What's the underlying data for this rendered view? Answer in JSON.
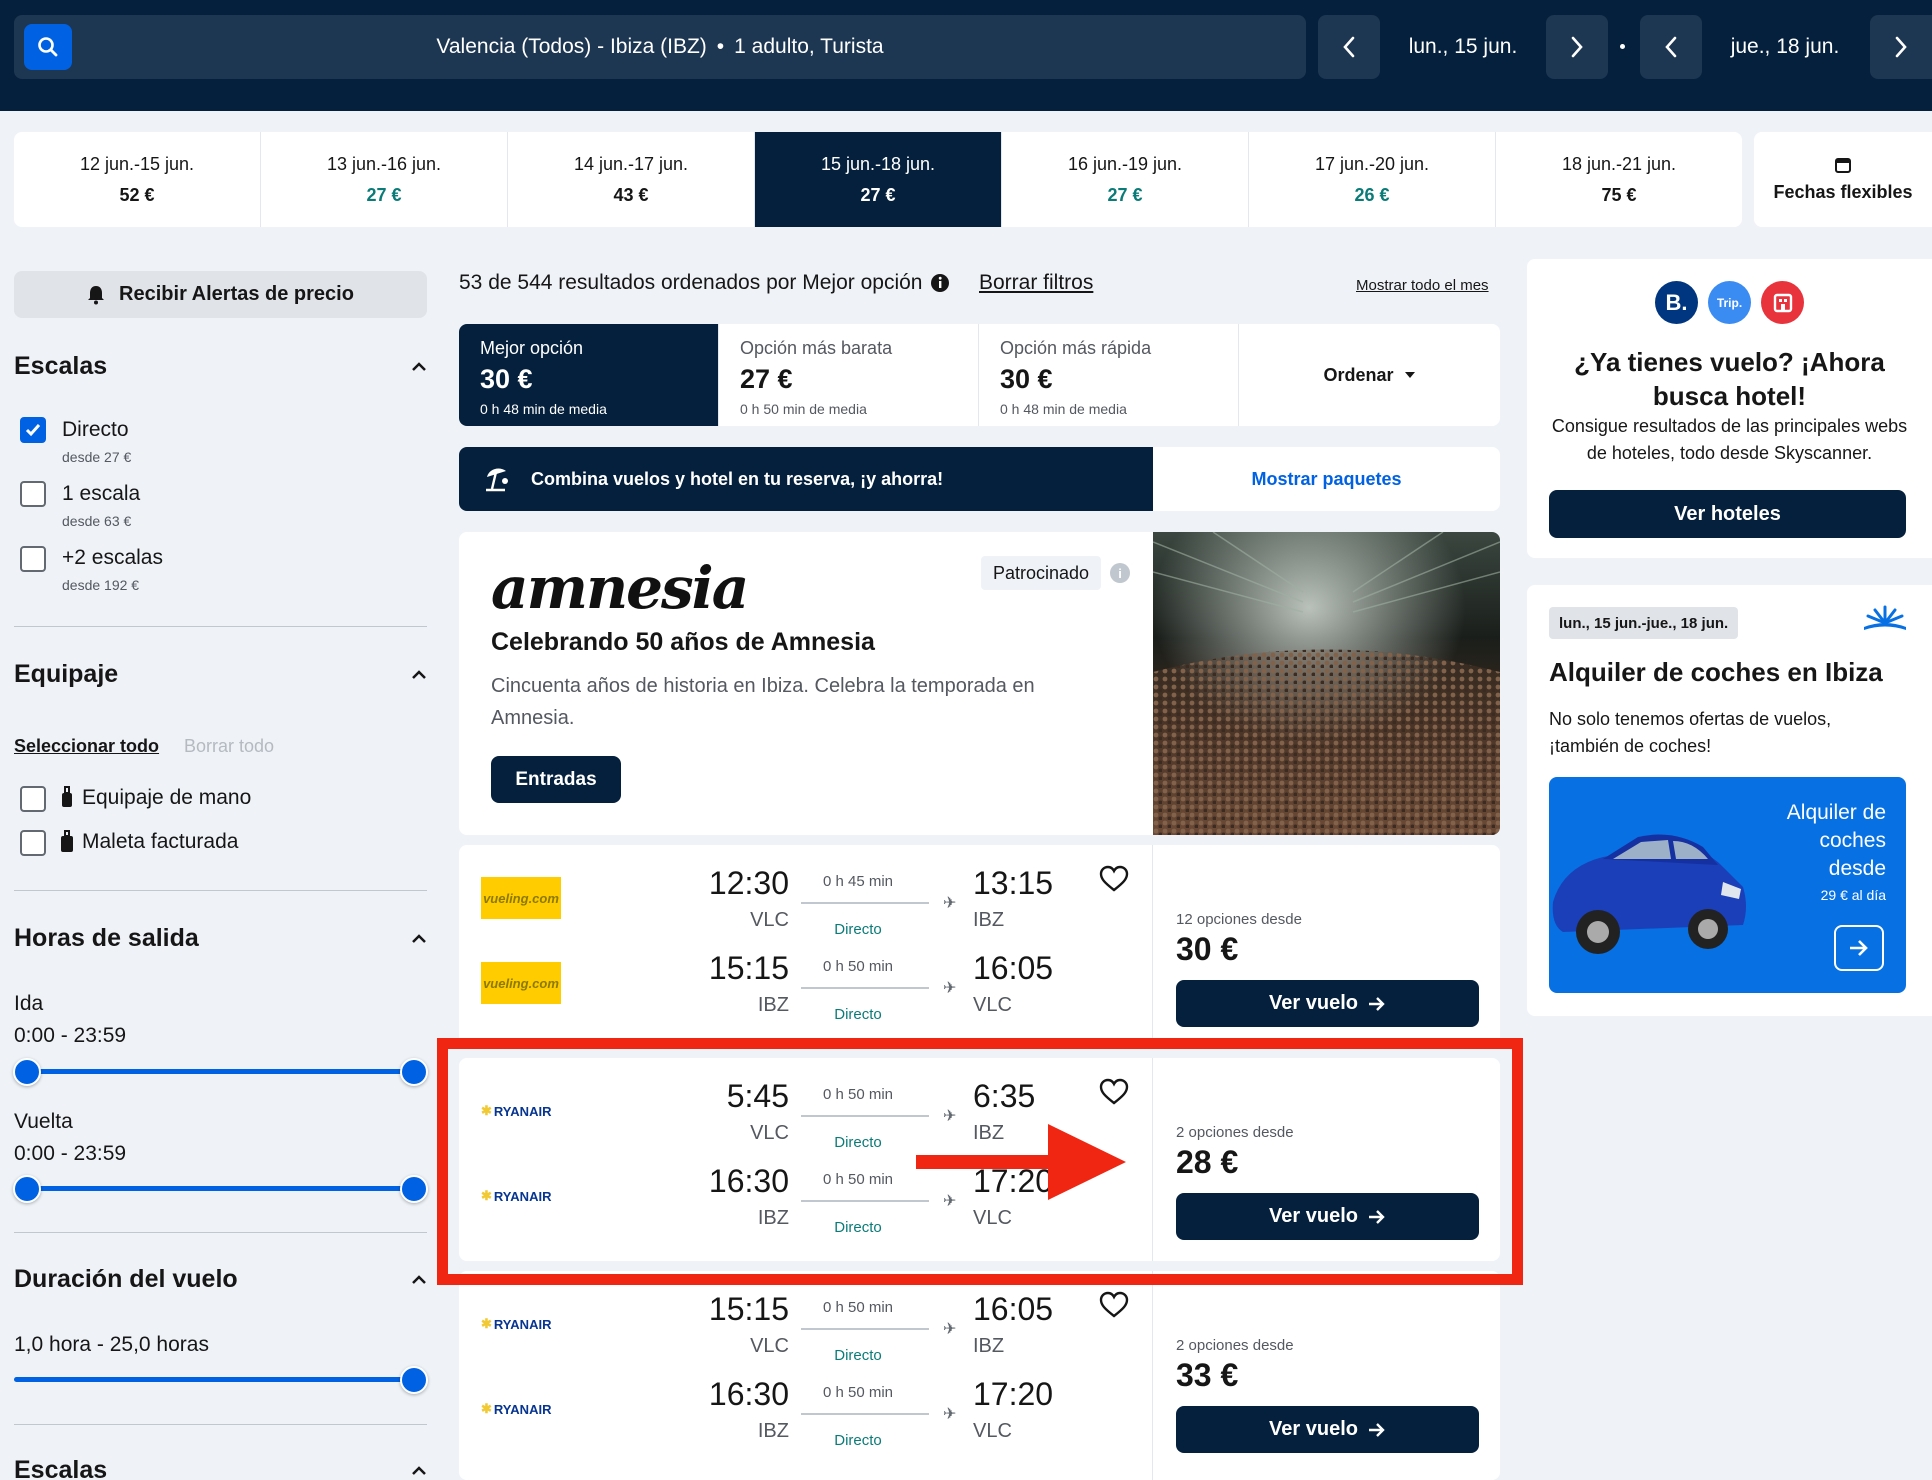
{
  "search": {
    "route": "Valencia (Todos) - Ibiza (IBZ)",
    "separator": "•",
    "passengers": "1 adulto, Turista",
    "depart_date": "lun., 15 jun.",
    "return_date": "jue., 18 jun."
  },
  "date_strip": [
    {
      "range": "12 jun.-15 jun.",
      "price": "52 €",
      "cheap": false,
      "selected": false
    },
    {
      "range": "13 jun.-16 jun.",
      "price": "27 €",
      "cheap": true,
      "selected": false
    },
    {
      "range": "14 jun.-17 jun.",
      "price": "43 €",
      "cheap": false,
      "selected": false
    },
    {
      "range": "15 jun.-18 jun.",
      "price": "27 €",
      "cheap": true,
      "selected": true
    },
    {
      "range": "16 jun.-19 jun.",
      "price": "27 €",
      "cheap": true,
      "selected": false
    },
    {
      "range": "17 jun.-20 jun.",
      "price": "26 €",
      "cheap": true,
      "selected": false
    },
    {
      "range": "18 jun.-21 jun.",
      "price": "75 €",
      "cheap": false,
      "selected": false
    }
  ],
  "flexible_dates": "Fechas flexibles",
  "filters": {
    "alert_button": "Recibir Alertas de precio",
    "stops_title": "Escalas",
    "stops": [
      {
        "label": "Directo",
        "sub": "desde 27 €",
        "checked": true
      },
      {
        "label": "1 escala",
        "sub": "desde 63 €",
        "checked": false
      },
      {
        "label": "+2 escalas",
        "sub": "desde 192 €",
        "checked": false
      }
    ],
    "baggage_title": "Equipaje",
    "select_all": "Seleccionar todo",
    "clear_all": "Borrar todo",
    "baggage": [
      {
        "label": "Equipaje de mano",
        "checked": false
      },
      {
        "label": "Maleta facturada",
        "checked": false
      }
    ],
    "times_title": "Horas de salida",
    "outbound_label": "Ida",
    "outbound_range": "0:00 - 23:59",
    "return_label": "Vuelta",
    "return_range": "0:00 - 23:59",
    "duration_title": "Duración del vuelo",
    "duration_range": "1,0 hora - 25,0 horas",
    "stops_title_2": "Escalas"
  },
  "results": {
    "summary": "53 de 544 resultados ordenados por Mejor opción",
    "clear_filters": "Borrar filtros",
    "whole_month": "Mostrar todo el mes",
    "sort_tabs": [
      {
        "label": "Mejor opción",
        "price": "30 €",
        "sub": "0 h 48 min de media",
        "selected": true
      },
      {
        "label": "Opción más barata",
        "price": "27 €",
        "sub": "0 h 50 min de media",
        "selected": false
      },
      {
        "label": "Opción más rápida",
        "price": "30 €",
        "sub": "0 h 48 min de media",
        "selected": false
      }
    ],
    "sort_button": "Ordenar"
  },
  "package_banner": {
    "text": "Combina vuelos y hotel en tu reserva, ¡y ahorra!",
    "link": "Mostrar paquetes"
  },
  "sponsored": {
    "logo": "amnesia",
    "badge": "Patrocinado",
    "title": "Celebrando 50 años de Amnesia",
    "description": "Cincuenta años de historia en Ibiza. Celebra la temporada en Amnesia.",
    "button": "Entradas"
  },
  "flights": [
    {
      "airline": "vueling",
      "airline_text": "vueling.com",
      "legs": [
        {
          "dep_time": "12:30",
          "dep_code": "VLC",
          "duration": "0 h 45 min",
          "stops": "Directo",
          "arr_time": "13:15",
          "arr_code": "IBZ"
        },
        {
          "dep_time": "15:15",
          "dep_code": "IBZ",
          "duration": "0 h 50 min",
          "stops": "Directo",
          "arr_time": "16:05",
          "arr_code": "VLC"
        }
      ],
      "options": "12 opciones desde",
      "price": "30 €",
      "button": "Ver vuelo"
    },
    {
      "airline": "ryanair",
      "airline_text": "RYANAIR",
      "legs": [
        {
          "dep_time": "5:45",
          "dep_code": "VLC",
          "duration": "0 h 50 min",
          "stops": "Directo",
          "arr_time": "6:35",
          "arr_code": "IBZ"
        },
        {
          "dep_time": "16:30",
          "dep_code": "IBZ",
          "duration": "0 h 50 min",
          "stops": "Directo",
          "arr_time": "17:20",
          "arr_code": "VLC"
        }
      ],
      "options": "2 opciones desde",
      "price": "28 €",
      "button": "Ver vuelo"
    },
    {
      "airline": "ryanair",
      "airline_text": "RYANAIR",
      "legs": [
        {
          "dep_time": "15:15",
          "dep_code": "VLC",
          "duration": "0 h 50 min",
          "stops": "Directo",
          "arr_time": "16:05",
          "arr_code": "IBZ"
        },
        {
          "dep_time": "16:30",
          "dep_code": "IBZ",
          "duration": "0 h 50 min",
          "stops": "Directo",
          "arr_time": "17:20",
          "arr_code": "VLC"
        }
      ],
      "options": "2 opciones desde",
      "price": "33 €",
      "button": "Ver vuelo"
    }
  ],
  "hotel_promo": {
    "icons": [
      "B.",
      "Trip."
    ],
    "title": "¿Ya tienes vuelo? ¡Ahora busca hotel!",
    "description": "Consigue resultados de las principales webs de hoteles, todo desde Skyscanner.",
    "button": "Ver hoteles"
  },
  "car_promo": {
    "dates": "lun., 15 jun.-jue., 18 jun.",
    "title": "Alquiler de coches en Ibiza",
    "description": "No solo tenemos ofertas de vuelos, ¡también de coches!",
    "promo_text": "Alquiler de coches desde",
    "promo_price": "29 € al día"
  },
  "colors": {
    "navy": "#05203c",
    "accent_blue": "#0062e3",
    "cheap_green": "#0b7b78",
    "highlight_red": "#f02612"
  }
}
